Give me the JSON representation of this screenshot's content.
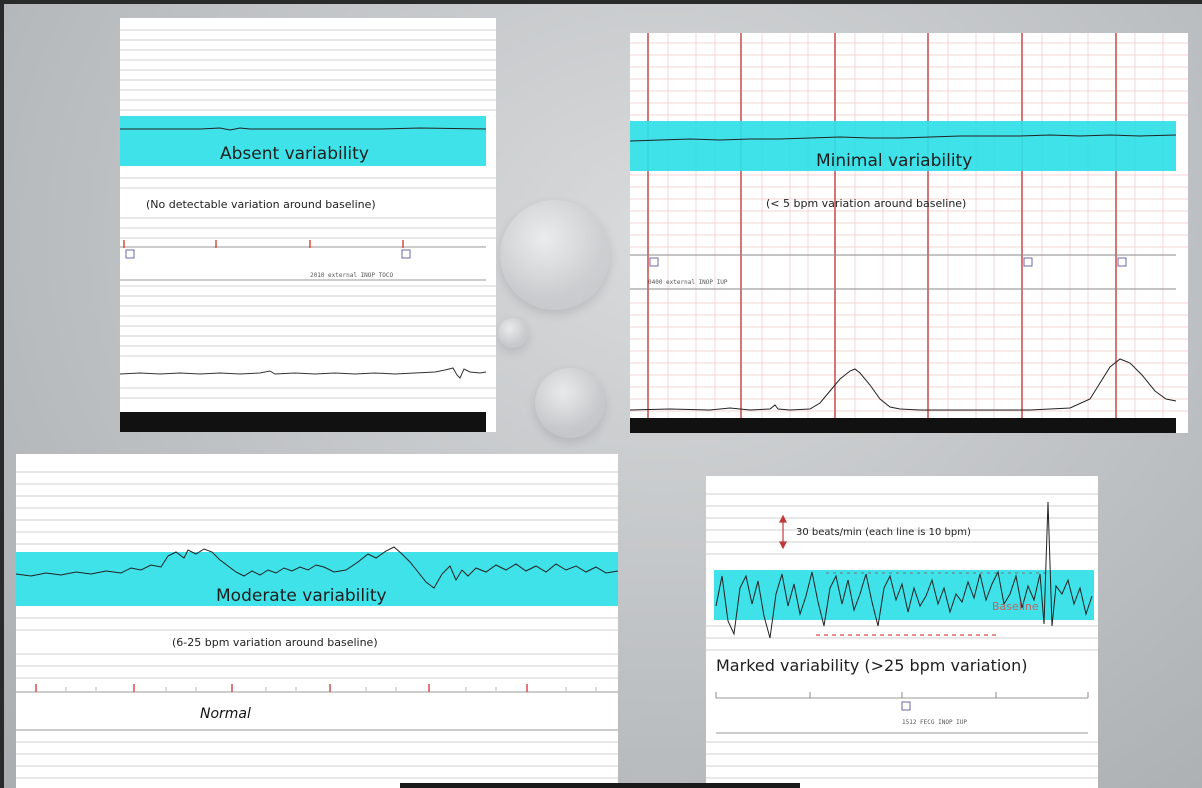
{
  "colors": {
    "highlight_band": "#2ee0e6",
    "grid_line": "#d2d2d2",
    "red_marker": "#d84a4a",
    "trace": "#222222",
    "background": "#c3c6c8"
  },
  "panels": [
    {
      "id": "absent",
      "title": "Absent variability",
      "subtitle": "(No detectable variation around baseline)",
      "annotation": "2010 external INOP TOCO"
    },
    {
      "id": "minimal",
      "title": "Minimal variability",
      "subtitle": "(< 5 bpm variation around baseline)",
      "annotation": "0400 external INOP IUP"
    },
    {
      "id": "moderate",
      "title": "Moderate variability",
      "subtitle": "(6-25 bpm variation around baseline)",
      "handwritten_note": "Normal"
    },
    {
      "id": "marked",
      "title": "Marked variability (>25 bpm variation)",
      "scale_note": "30 beats/min (each line is 10 bpm)",
      "baseline_label": "Baseline",
      "annotation": "1512 FECG INOP IUP"
    }
  ]
}
